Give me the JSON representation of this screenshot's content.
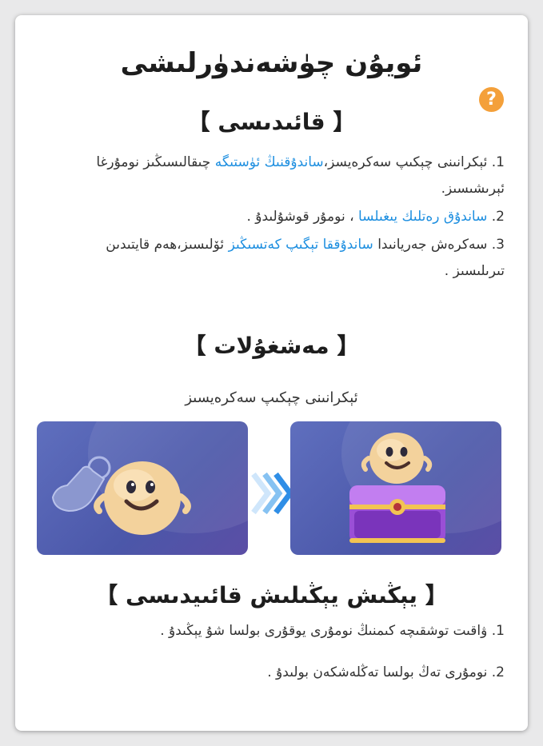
{
  "header": {
    "title": "ئويۇن چۈشەندۈرلىشى",
    "help_glyph": "?"
  },
  "rules_section": {
    "heading": "【 قائىدىسى 】",
    "items": [
      {
        "num": "1.",
        "before": "ئېكرانىنى چېكىپ سەكرەيسز،",
        "link": "ساندۇقنىڭ ئۈستىگە",
        "after": " چىقالىسىڭىز نومۇرغا ئېرىشىسىز."
      },
      {
        "num": "2.",
        "before": "",
        "link": "ساندۇق رەتلىك يىغىلسا",
        "after": " ، نومۇر قوشۇلىدۇ ."
      },
      {
        "num": "3.",
        "before": "سەكرەش جەريانىدا ",
        "link": "ساندۇققا تېگىپ كەتسىڭىز",
        "after": " ئۆلىسىز،ھەم قايتىدىن تىرىلىسىز ."
      }
    ]
  },
  "operation_section": {
    "heading": "【 مەشغۇلات 】",
    "subtitle": "ئېكرانىنى چېكىپ سەكرەيسىز"
  },
  "end_section": {
    "heading": "【 يېڭىش يېڭىلىش قائىيدىسى 】",
    "items": [
      {
        "num": "1.",
        "text": "ۋاقىت توشقىچە كىمنىڭ نومۇرى يوقۇرى بولسا شۇ يېڭىدۇ ."
      },
      {
        "num": "2.",
        "text": "نومۇرى تەڭ بولسا تەڭلەشكەن بولىدۇ ."
      }
    ]
  },
  "colors": {
    "accent": "#1e8fe0",
    "help": "#f4a03a",
    "panel": "#4b57a9"
  }
}
